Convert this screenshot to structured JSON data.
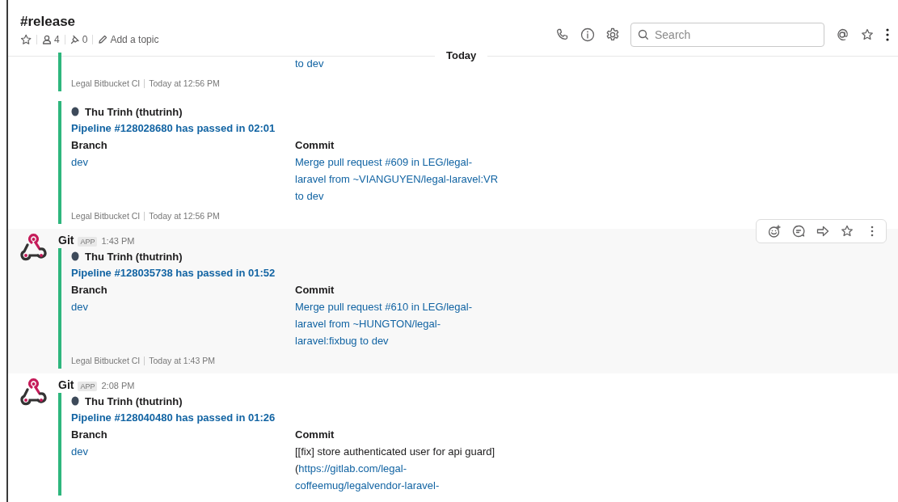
{
  "channel": {
    "name": "#release",
    "members": "4",
    "pins": "0",
    "topic": "Add a topic"
  },
  "search": {
    "placeholder": "Search"
  },
  "day_divider": "Today",
  "messages": [
    {
      "kind": "continuation",
      "hovered": false,
      "attachments": [
        {
          "fields": [
            {
              "kind": "commit",
              "lines": [
                [
                  {
                    "text": "to dev",
                    "link": true
                  }
                ]
              ]
            }
          ],
          "footer_source": "Legal Bitbucket CI",
          "footer_time": "Today at 12:56 PM"
        }
      ]
    },
    {
      "kind": "continuation",
      "hovered": false,
      "attachments": [
        {
          "author": "Thu Trinh (thutrinh)",
          "title": "Pipeline #128028680 has passed in 02:01",
          "fields": [
            {
              "kind": "branch",
              "label": "Branch",
              "lines": [
                [
                  {
                    "text": "dev",
                    "link": true
                  }
                ]
              ]
            },
            {
              "kind": "commit",
              "label": "Commit",
              "lines": [
                [
                  {
                    "text": "Merge pull request #609 in LEG/legal-",
                    "link": true
                  }
                ],
                [
                  {
                    "text": "laravel from ~VIANGUYEN/legal-laravel:VR",
                    "link": true
                  }
                ],
                [
                  {
                    "text": "to dev",
                    "link": true
                  }
                ]
              ]
            }
          ],
          "footer_source": "Legal Bitbucket CI",
          "footer_time": "Today at 12:56 PM"
        }
      ]
    },
    {
      "kind": "app",
      "sender": "Git",
      "badge": "APP",
      "time": "1:43 PM",
      "hovered": true,
      "attachments": [
        {
          "author": "Thu Trinh (thutrinh)",
          "title": "Pipeline #128035738 has passed in 01:52",
          "fields": [
            {
              "kind": "branch",
              "label": "Branch",
              "lines": [
                [
                  {
                    "text": "dev",
                    "link": true
                  }
                ]
              ]
            },
            {
              "kind": "commit",
              "label": "Commit",
              "lines": [
                [
                  {
                    "text": "Merge pull request #610 in LEG/legal-",
                    "link": true
                  }
                ],
                [
                  {
                    "text": "laravel from ~HUNGTON/legal-",
                    "link": true
                  }
                ],
                [
                  {
                    "text": "laravel:fixbug to dev",
                    "link": true
                  }
                ]
              ]
            }
          ],
          "footer_source": "Legal Bitbucket CI",
          "footer_time": "Today at 1:43 PM"
        }
      ]
    },
    {
      "kind": "app",
      "sender": "Git",
      "badge": "APP",
      "time": "2:08 PM",
      "hovered": false,
      "attachments": [
        {
          "author": "Thu Trinh (thutrinh)",
          "title": "Pipeline #128040480 has passed in 01:26",
          "fields": [
            {
              "kind": "branch",
              "label": "Branch",
              "lines": [
                [
                  {
                    "text": "dev",
                    "link": true
                  }
                ]
              ]
            },
            {
              "kind": "commit",
              "label": "Commit",
              "lines": [
                [
                  {
                    "text": "[[fix] store authenticated user for api guard]",
                    "link": false
                  }
                ],
                [
                  {
                    "text": "(",
                    "link": false
                  },
                  {
                    "text": "https://gitlab.com/legal-",
                    "link": true
                  }
                ],
                [
                  {
                    "text": "coffeemug/legalvendor-laravel-",
                    "link": true
                  }
                ]
              ]
            }
          ]
        }
      ]
    }
  ]
}
